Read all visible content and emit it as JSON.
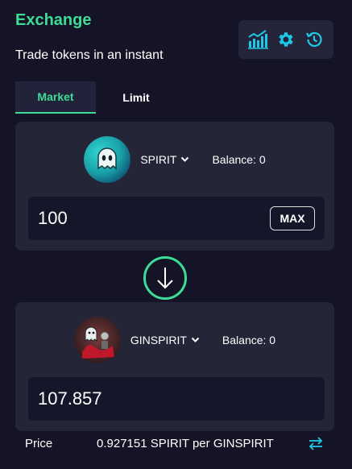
{
  "header": {
    "title": "Exchange",
    "subtitle": "Trade tokens in an instant"
  },
  "toolbar": {
    "icons": [
      "chart-icon",
      "gear-icon",
      "history-icon"
    ],
    "accent": "#1ec8e6"
  },
  "tabs": [
    {
      "label": "Market",
      "active": true
    },
    {
      "label": "Limit",
      "active": false
    }
  ],
  "from": {
    "token": "SPIRIT",
    "balance": "Balance: 0",
    "amount": "100",
    "max_label": "MAX"
  },
  "to": {
    "token": "GINSPIRIT",
    "balance": "Balance: 0",
    "amount": "107.857"
  },
  "price": {
    "label": "Price",
    "value": "0.927151 SPIRIT per GINSPIRIT"
  },
  "colors": {
    "accent_green": "#3ddc97",
    "background": "#141426",
    "card": "#252538",
    "input": "#16162a"
  }
}
